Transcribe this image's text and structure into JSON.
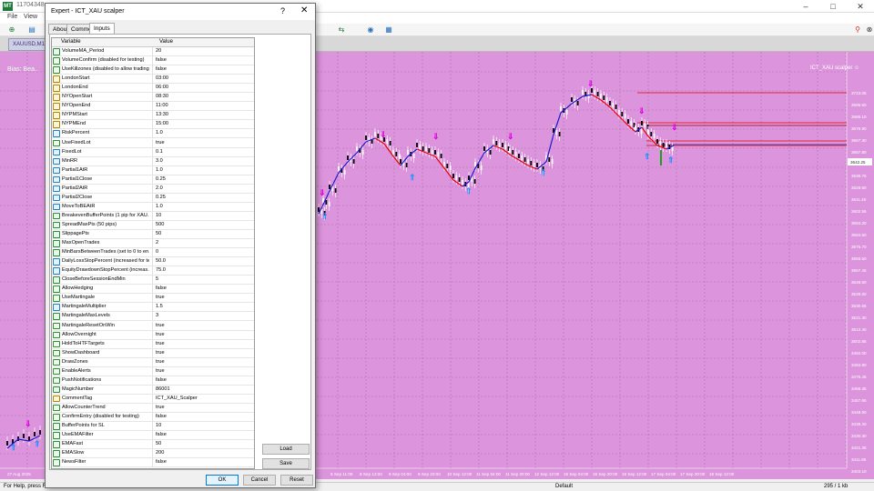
{
  "app": {
    "title": "11704348",
    "menu": [
      "File",
      "View"
    ],
    "window_controls": [
      "–",
      "□",
      "✕"
    ]
  },
  "chart_tab": {
    "label": "XAUUSD,M15"
  },
  "chart_header": {
    "symbol": "XAUUSD,M15",
    "bias": "Bias: Bea..",
    "indicator_label": "ICT_XAU scalper ☺"
  },
  "price_axis": [
    "3723.05",
    "3695.50",
    "3686.10",
    "3676.90",
    "3667.30",
    "3657.80",
    "3649.05",
    "3638.75",
    "3629.50",
    "3611.40",
    "3602.55",
    "3594.20",
    "3584.60",
    "3575.70",
    "3566.50",
    "3557.45",
    "3548.60",
    "3539.50",
    "3530.65",
    "3521.30",
    "3512.40",
    "3502.85",
    "3494.00",
    "3484.90",
    "3475.45",
    "3466.35",
    "3457.65",
    "3448.50",
    "3439.20",
    "3430.30",
    "3421.35",
    "3411.95",
    "3403.10",
    "3394.55",
    "3385.20"
  ],
  "price_current": "3642.25",
  "time_axis": [
    "27 Aug 2025",
    "5 Sep 11:00",
    "8 Sep 12:00",
    "9 Sep 04:00",
    "9 Sep 20:00",
    "10 Sep 12:00",
    "11 Sep 04:00",
    "11 Sep 20:00",
    "12 Sep 12:00",
    "15 Sep 04:00",
    "15 Sep 20:00",
    "16 Sep 12:00",
    "17 Sep 04:00",
    "17 Sep 20:00",
    "18 Sep 12:00"
  ],
  "status": {
    "help": "For Help, press F1",
    "profile": "Default",
    "traffic": "295 / 1 kb"
  },
  "colors": {
    "chart_bg": "#dc95dc",
    "ma_up": "#1a1acc",
    "ma_down": "#e60000",
    "arrow_up": "#1e90ff",
    "arrow_down": "#e000e0",
    "level": "#e60000"
  },
  "dialog": {
    "title": "Expert - ICT_XAU scalper",
    "help": "?",
    "close": "✕",
    "tabs": [
      "About",
      "Common",
      "Inputs"
    ],
    "columns": {
      "variable": "Variable",
      "value": "Value"
    },
    "buttons": {
      "load": "Load",
      "save": "Save",
      "ok": "OK",
      "cancel": "Cancel",
      "reset": "Reset"
    },
    "params": [
      {
        "n": "VolumeMA_Period",
        "v": "20",
        "t": "int"
      },
      {
        "n": "VolumeConfirm (disabled for testing)",
        "v": "false",
        "t": "bool"
      },
      {
        "n": "UseKillzones (disabled to allow trading ...",
        "v": "false",
        "t": "bool"
      },
      {
        "n": "LondonStart",
        "v": "03:00",
        "t": "str"
      },
      {
        "n": "LondonEnd",
        "v": "06:00",
        "t": "str"
      },
      {
        "n": "NYOpenStart",
        "v": "08:30",
        "t": "str"
      },
      {
        "n": "NYOpenEnd",
        "v": "11:00",
        "t": "str"
      },
      {
        "n": "NYPMStart",
        "v": "13:30",
        "t": "str"
      },
      {
        "n": "NYPMEnd",
        "v": "15:00",
        "t": "str"
      },
      {
        "n": "RiskPercent",
        "v": "1.0",
        "t": "dbl"
      },
      {
        "n": "UseFixedLot",
        "v": "true",
        "t": "bool"
      },
      {
        "n": "FixedLot",
        "v": "0.1",
        "t": "dbl"
      },
      {
        "n": "MinRR",
        "v": "3.0",
        "t": "dbl"
      },
      {
        "n": "Partial1AtR",
        "v": "1.0",
        "t": "dbl"
      },
      {
        "n": "Partial1Close",
        "v": "0.25",
        "t": "dbl"
      },
      {
        "n": "Partial2AtR",
        "v": "2.0",
        "t": "dbl"
      },
      {
        "n": "Partial2Close",
        "v": "0.25",
        "t": "dbl"
      },
      {
        "n": "MoveToBEAtR",
        "v": "1.0",
        "t": "dbl"
      },
      {
        "n": "BreakevenBufferPoints (1 pip for XAU...",
        "v": "10",
        "t": "int"
      },
      {
        "n": "SpreadMaxPts (50 pips)",
        "v": "500",
        "t": "int"
      },
      {
        "n": "SlippagePts",
        "v": "50",
        "t": "int"
      },
      {
        "n": "MaxOpenTrades",
        "v": "2",
        "t": "int"
      },
      {
        "n": "MinBarsBetweenTrades (set to 0 to en...",
        "v": "0",
        "t": "int"
      },
      {
        "n": "DailyLossStopPercent (increased for te...",
        "v": "50.0",
        "t": "dbl"
      },
      {
        "n": "EquityDrawdownStopPercent (increas...",
        "v": "75.0",
        "t": "dbl"
      },
      {
        "n": "CloseBeforeSessionEndMin",
        "v": "5",
        "t": "int"
      },
      {
        "n": "AllowHedging",
        "v": "false",
        "t": "bool"
      },
      {
        "n": "UseMartingale",
        "v": "true",
        "t": "bool"
      },
      {
        "n": "MartingaleMultiplier",
        "v": "1.5",
        "t": "dbl"
      },
      {
        "n": "MartingaleMaxLevels",
        "v": "3",
        "t": "int"
      },
      {
        "n": "MartingaleResetOnWin",
        "v": "true",
        "t": "bool"
      },
      {
        "n": "AllowOvernight",
        "v": "true",
        "t": "bool"
      },
      {
        "n": "HoldToHTFTargets",
        "v": "true",
        "t": "bool"
      },
      {
        "n": "ShowDashboard",
        "v": "true",
        "t": "bool"
      },
      {
        "n": "DrawZones",
        "v": "true",
        "t": "bool"
      },
      {
        "n": "EnableAlerts",
        "v": "true",
        "t": "bool"
      },
      {
        "n": "PushNotifications",
        "v": "false",
        "t": "bool"
      },
      {
        "n": "MagicNumber",
        "v": "86001",
        "t": "int"
      },
      {
        "n": "CommentTag",
        "v": "ICT_XAU_Scalper",
        "t": "str"
      },
      {
        "n": "AllowCounterTrend",
        "v": "true",
        "t": "bool"
      },
      {
        "n": "ConfirmEntry (disabled for testing)",
        "v": "false",
        "t": "bool"
      },
      {
        "n": "BufferPoints for SL",
        "v": "10",
        "t": "int"
      },
      {
        "n": "UseEMAFilter",
        "v": "false",
        "t": "bool"
      },
      {
        "n": "EMAFast",
        "v": "50",
        "t": "int"
      },
      {
        "n": "EMASlow",
        "v": "200",
        "t": "int"
      },
      {
        "n": "NewsFilter",
        "v": "false",
        "t": "bool"
      }
    ]
  }
}
